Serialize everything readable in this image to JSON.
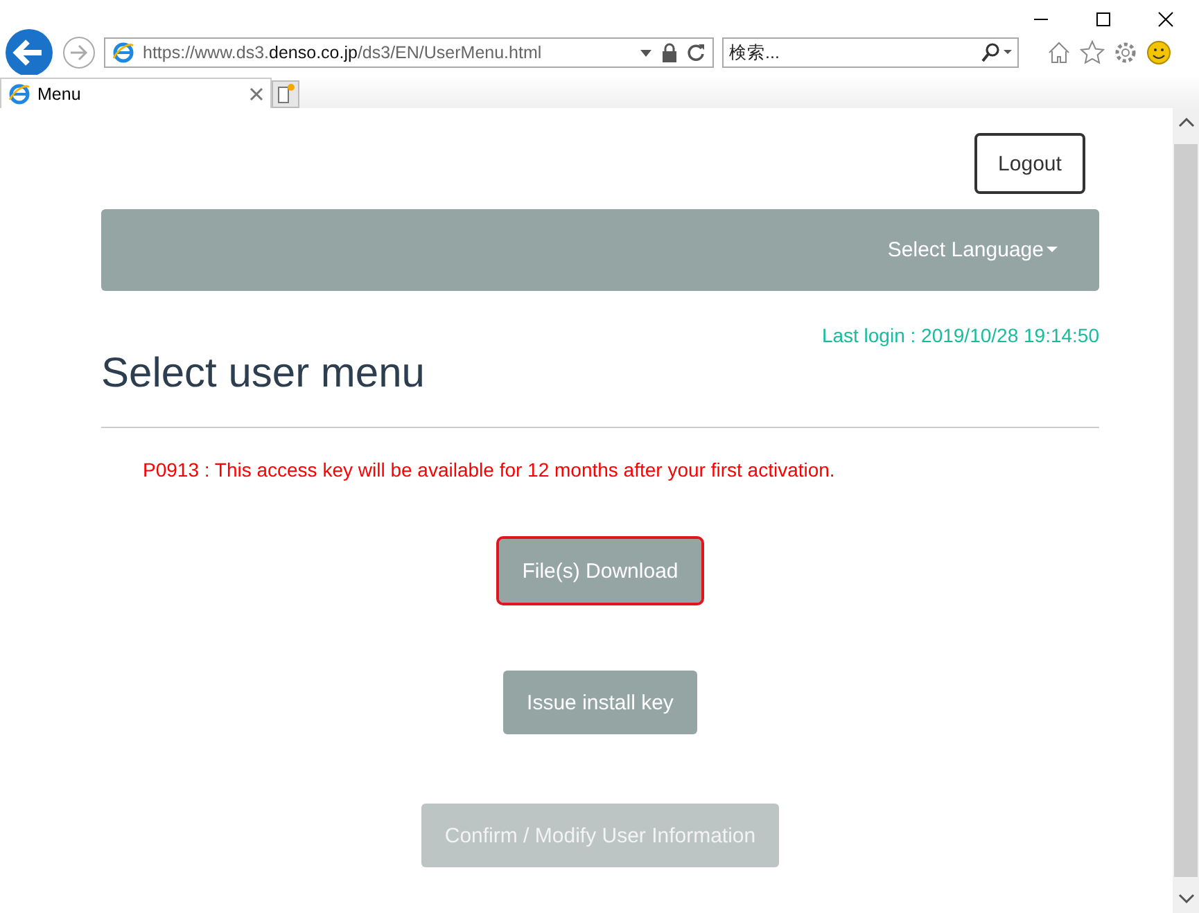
{
  "browser": {
    "address": {
      "prefix": "https://www.ds3.",
      "domain": "denso.co.jp",
      "path": "/ds3/EN/UserMenu.html"
    },
    "search": {
      "placeholder": "検索..."
    },
    "tabs": [
      {
        "label": "Menu",
        "selected": true
      }
    ]
  },
  "page": {
    "logout": "Logout",
    "navbar": {
      "language": "Select Language"
    },
    "last_login": "Last login : 2019/10/28 19:14:50",
    "title": "Select user menu",
    "notice": "P0913 : This access key will be available for 12 months after your first activation.",
    "menu": [
      {
        "label": "File(s) Download",
        "selected": true,
        "disabled": false
      },
      {
        "label": "Issue install key",
        "selected": false,
        "disabled": false
      },
      {
        "label": "Confirm / Modify User Information",
        "selected": false,
        "disabled": true
      }
    ]
  }
}
